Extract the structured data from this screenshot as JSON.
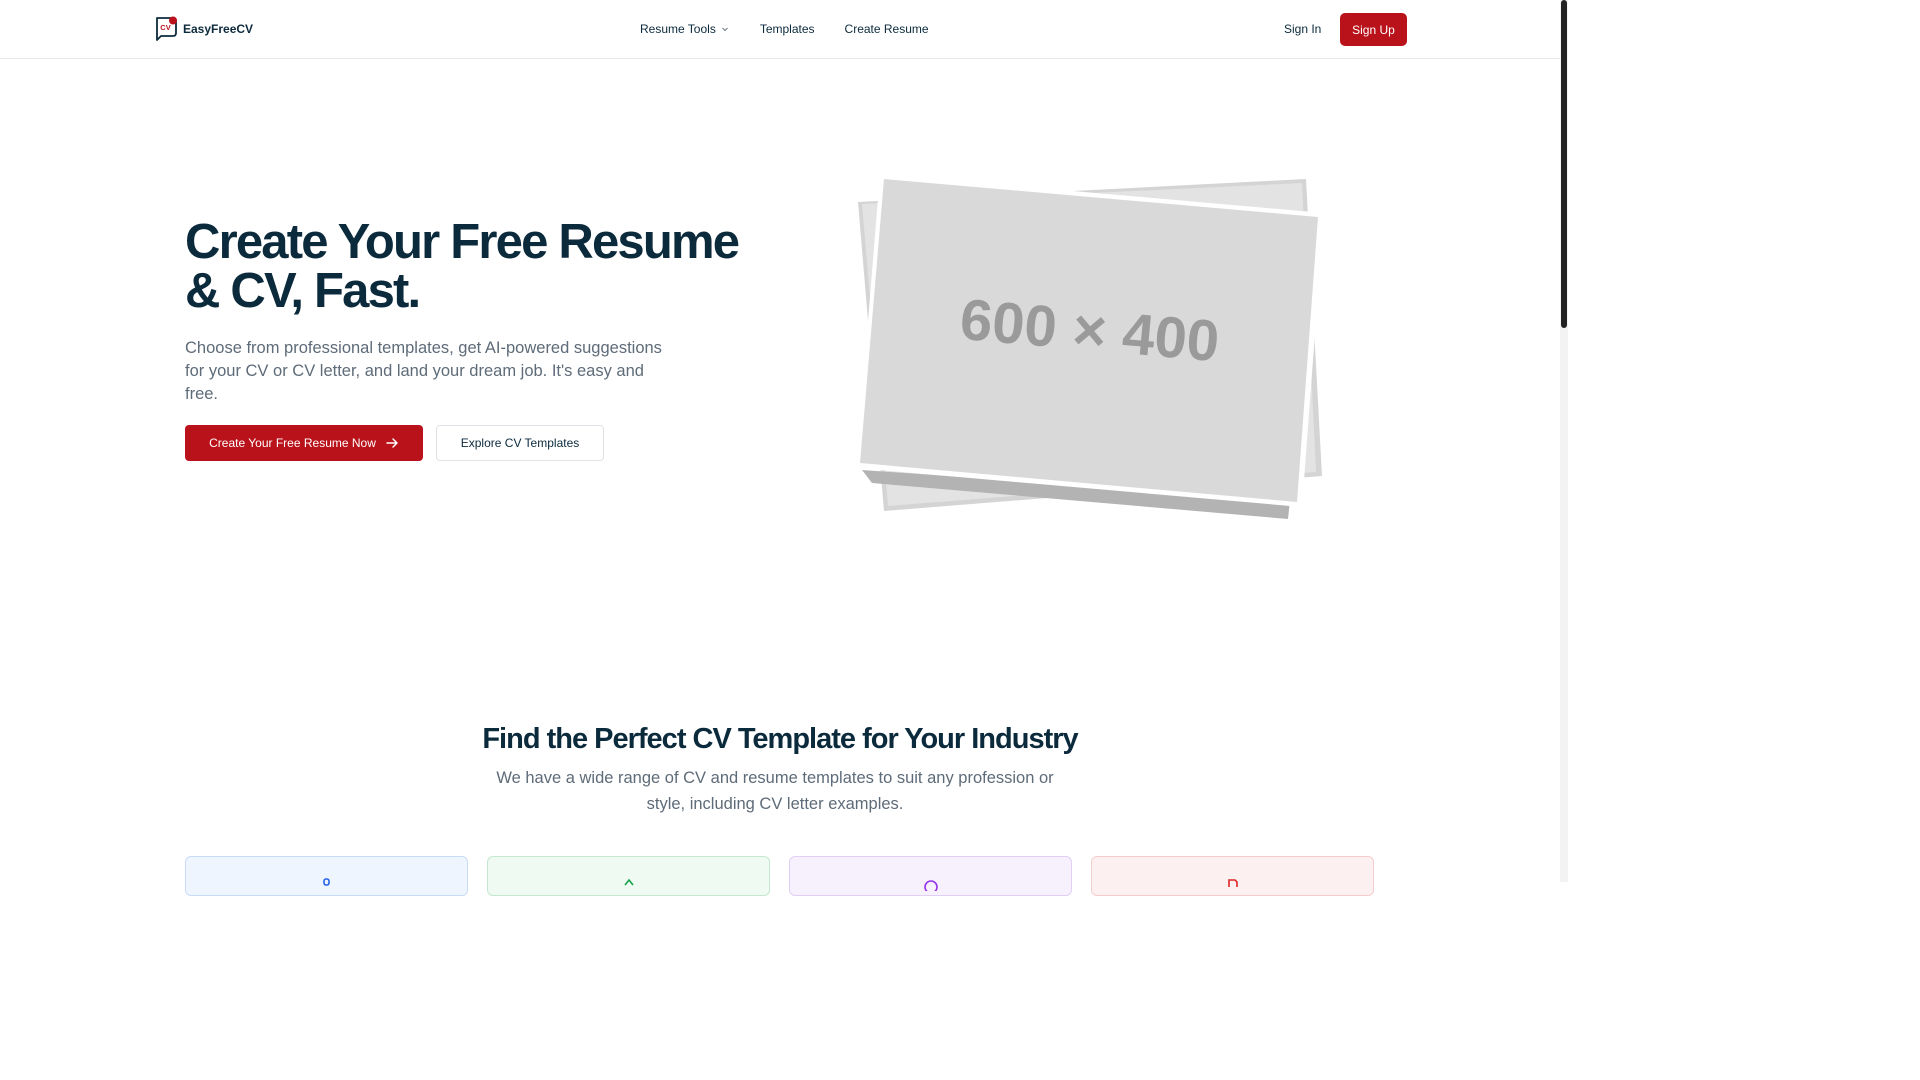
{
  "header": {
    "logo_badge": "CV",
    "logo_text": "EasyFreeCV",
    "nav": [
      {
        "label": "Resume Tools"
      },
      {
        "label": "Templates"
      },
      {
        "label": "Create Resume"
      }
    ],
    "sign_in": "Sign In",
    "sign_up": "Sign Up"
  },
  "hero": {
    "title_line1": "Create Your Free Resume",
    "title_line2": "& CV, Fast.",
    "subtitle": "Choose from professional templates, get AI-powered suggestions for your CV or CV letter, and land your dream job. It's easy and free.",
    "primary_button": "Create Your Free Resume Now",
    "secondary_button": "Explore CV Templates",
    "image_placeholder": "600 × 400"
  },
  "industry_section": {
    "title": "Find the Perfect CV Template for Your Industry",
    "subtitle": "We have a wide range of CV and resume templates to suit any profession or style, including CV letter examples."
  },
  "colors": {
    "brand": "#b9121b",
    "heading": "#0b2a3c",
    "body_text": "#5e6b78"
  },
  "icons": [
    "cv-logo-icon",
    "chevron-down-icon",
    "arrow-right-icon",
    "user-icon",
    "growth-icon",
    "design-icon",
    "document-icon"
  ]
}
